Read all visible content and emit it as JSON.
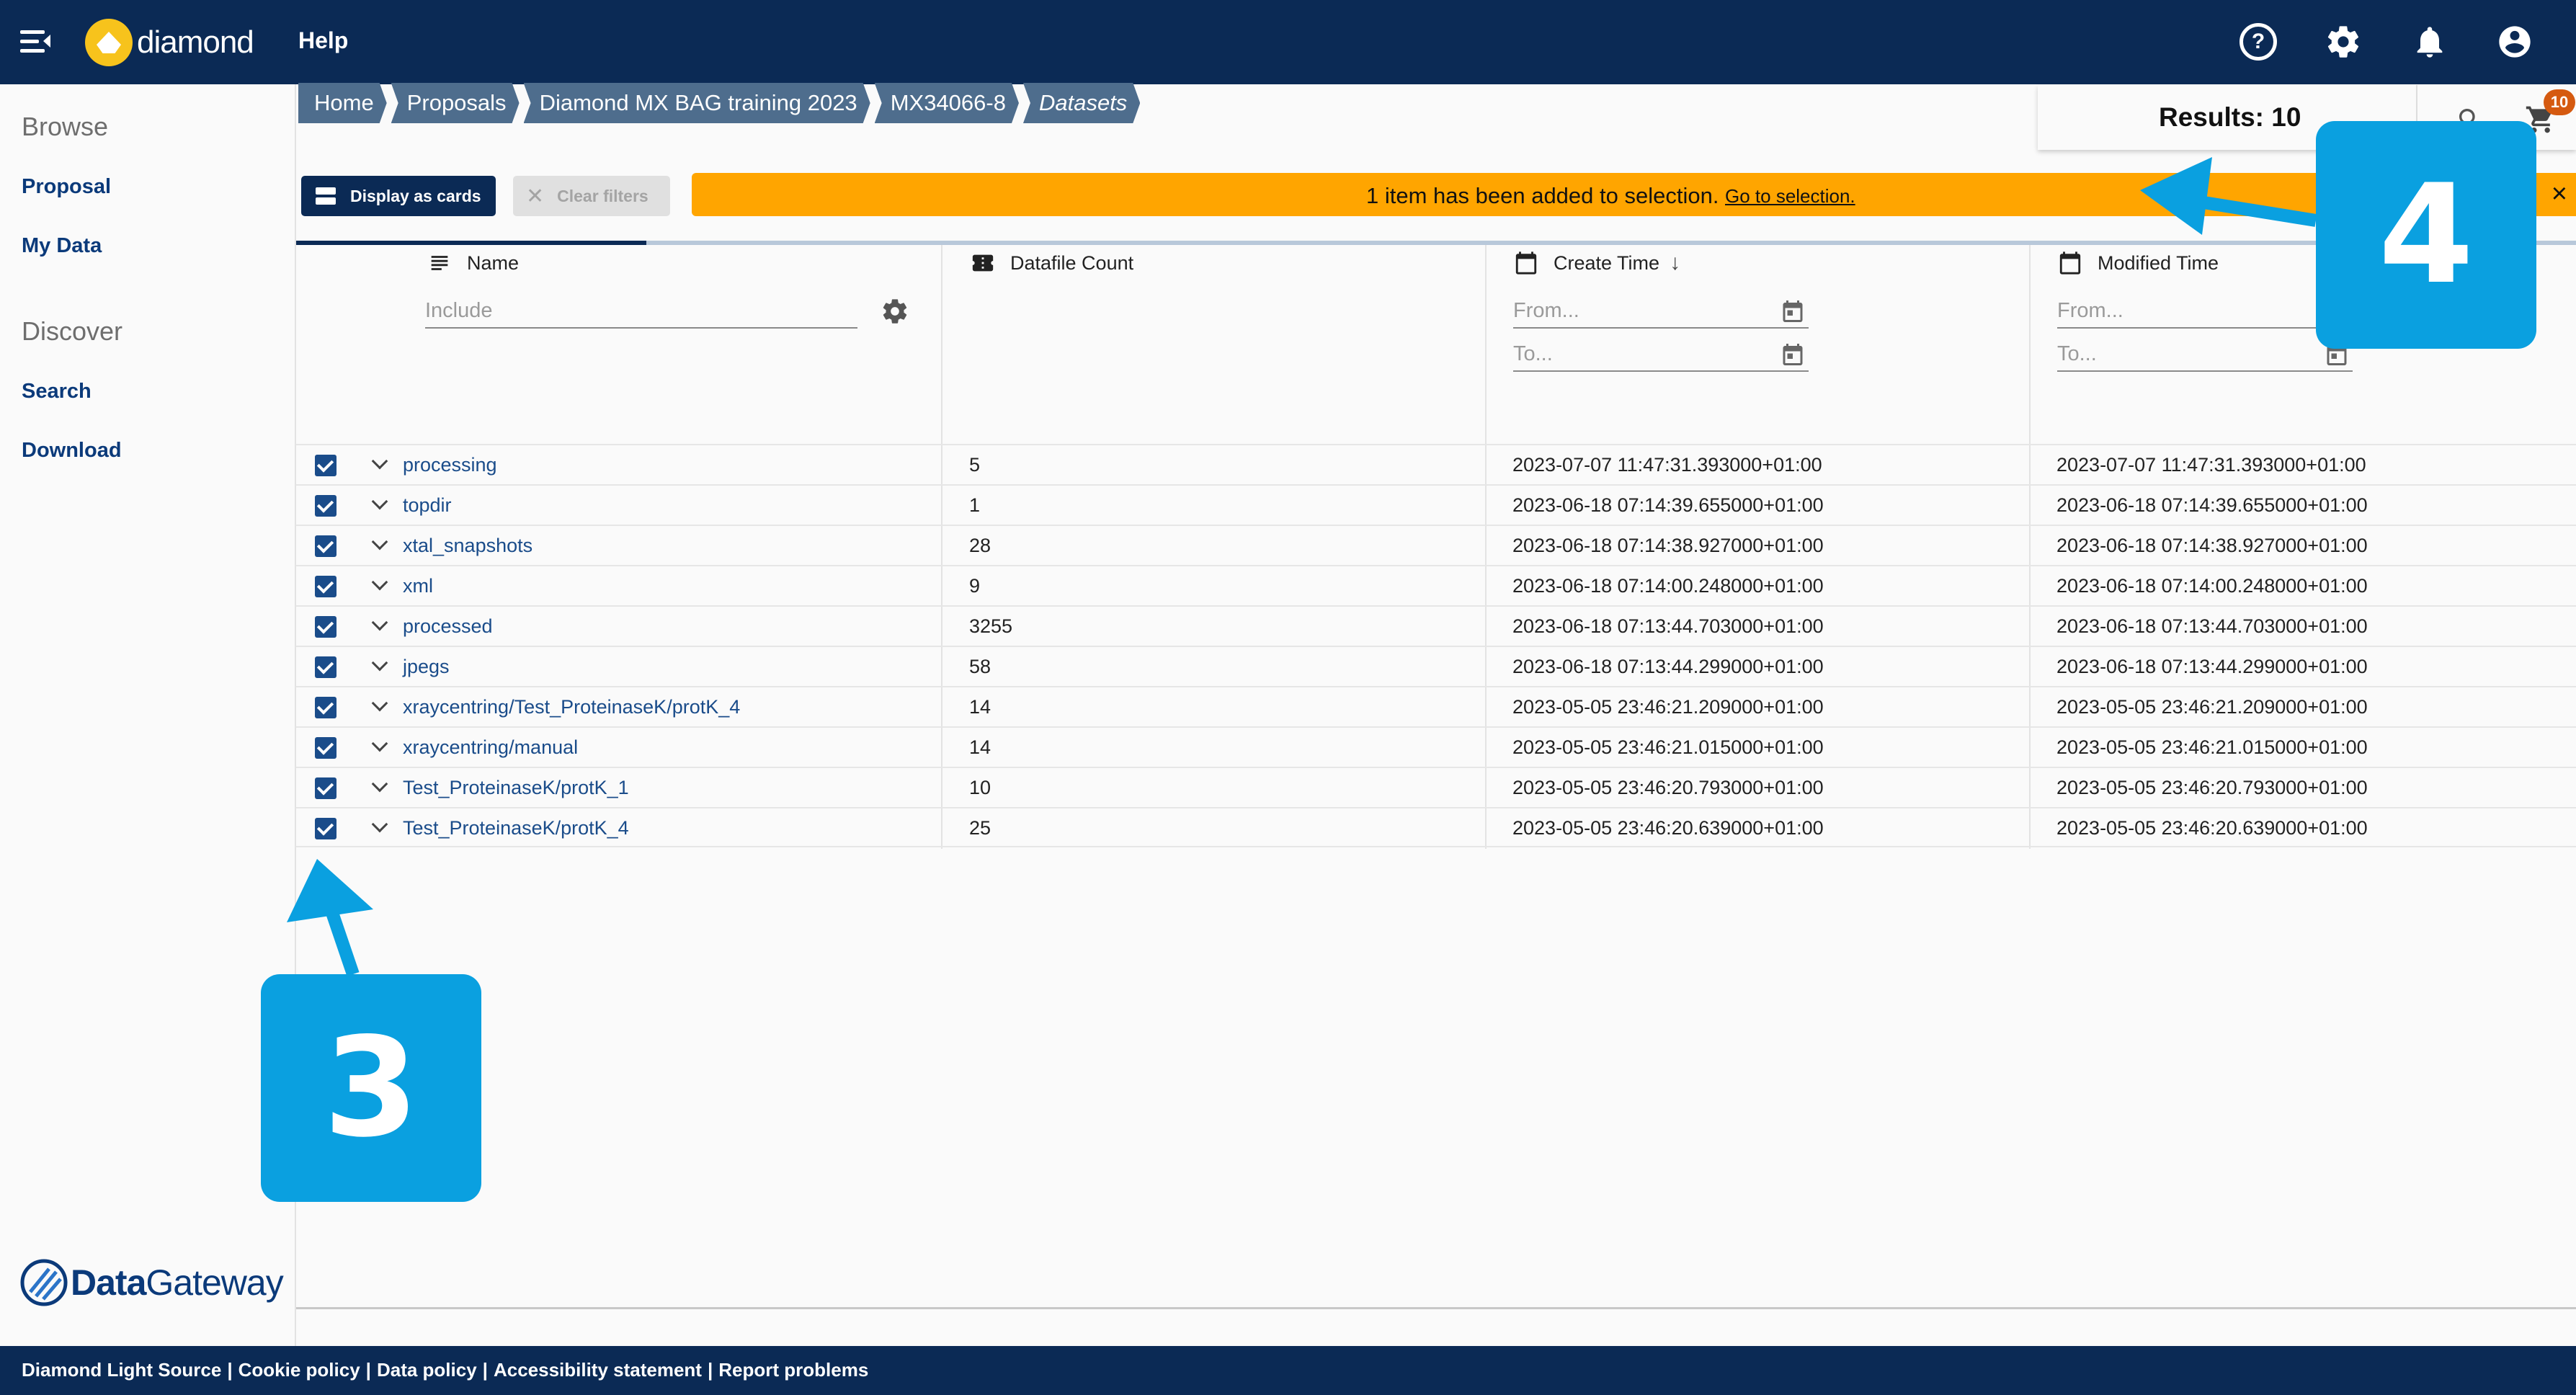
{
  "header": {
    "logo_text": "diamond",
    "help_label": "Help"
  },
  "sidebar": {
    "browse_heading": "Browse",
    "browse_items": [
      "Proposal",
      "My Data"
    ],
    "discover_heading": "Discover",
    "discover_items": [
      "Search",
      "Download"
    ],
    "brand_bold": "Data",
    "brand_light": "Gateway"
  },
  "breadcrumb": [
    "Home",
    "Proposals",
    "Diamond MX BAG training 2023",
    "MX34066-8",
    "Datasets"
  ],
  "results": {
    "label": "Results: 10",
    "cart_count": "10"
  },
  "toolbar": {
    "display_cards_label": "Display as cards",
    "clear_filters_label": "Clear filters"
  },
  "banner": {
    "message": "1 item has been added to selection.",
    "link": "Go to selection."
  },
  "table": {
    "columns": {
      "name": "Name",
      "count": "Datafile Count",
      "create": "Create Time",
      "modified": "Modified Time"
    },
    "filters": {
      "include_placeholder": "Include",
      "from_placeholder": "From...",
      "to_placeholder": "To..."
    },
    "rows": [
      {
        "name": "processing",
        "count": "5",
        "created": "2023-07-07 11:47:31.393000+01:00",
        "modified": "2023-07-07 11:47:31.393000+01:00"
      },
      {
        "name": "topdir",
        "count": "1",
        "created": "2023-06-18 07:14:39.655000+01:00",
        "modified": "2023-06-18 07:14:39.655000+01:00"
      },
      {
        "name": "xtal_snapshots",
        "count": "28",
        "created": "2023-06-18 07:14:38.927000+01:00",
        "modified": "2023-06-18 07:14:38.927000+01:00"
      },
      {
        "name": "xml",
        "count": "9",
        "created": "2023-06-18 07:14:00.248000+01:00",
        "modified": "2023-06-18 07:14:00.248000+01:00"
      },
      {
        "name": "processed",
        "count": "3255",
        "created": "2023-06-18 07:13:44.703000+01:00",
        "modified": "2023-06-18 07:13:44.703000+01:00"
      },
      {
        "name": "jpegs",
        "count": "58",
        "created": "2023-06-18 07:13:44.299000+01:00",
        "modified": "2023-06-18 07:13:44.299000+01:00"
      },
      {
        "name": "xraycentring/Test_ProteinaseK/protK_4",
        "count": "14",
        "created": "2023-05-05 23:46:21.209000+01:00",
        "modified": "2023-05-05 23:46:21.209000+01:00"
      },
      {
        "name": "xraycentring/manual",
        "count": "14",
        "created": "2023-05-05 23:46:21.015000+01:00",
        "modified": "2023-05-05 23:46:21.015000+01:00"
      },
      {
        "name": "Test_ProteinaseK/protK_1",
        "count": "10",
        "created": "2023-05-05 23:46:20.793000+01:00",
        "modified": "2023-05-05 23:46:20.793000+01:00"
      },
      {
        "name": "Test_ProteinaseK/protK_4",
        "count": "25",
        "created": "2023-05-05 23:46:20.639000+01:00",
        "modified": "2023-05-05 23:46:20.639000+01:00"
      }
    ]
  },
  "footer": {
    "links": [
      "Diamond Light Source",
      "Cookie policy",
      "Data policy",
      "Accessibility statement",
      "Report problems"
    ]
  },
  "callouts": {
    "left": "3",
    "right": "4"
  },
  "colors": {
    "header_bg": "#0b2a55",
    "banner_bg": "#ffa500",
    "breadcrumb_bg": "#4e6d8d",
    "callout_bg": "#0aa0e0",
    "link": "#1a4c8a"
  }
}
